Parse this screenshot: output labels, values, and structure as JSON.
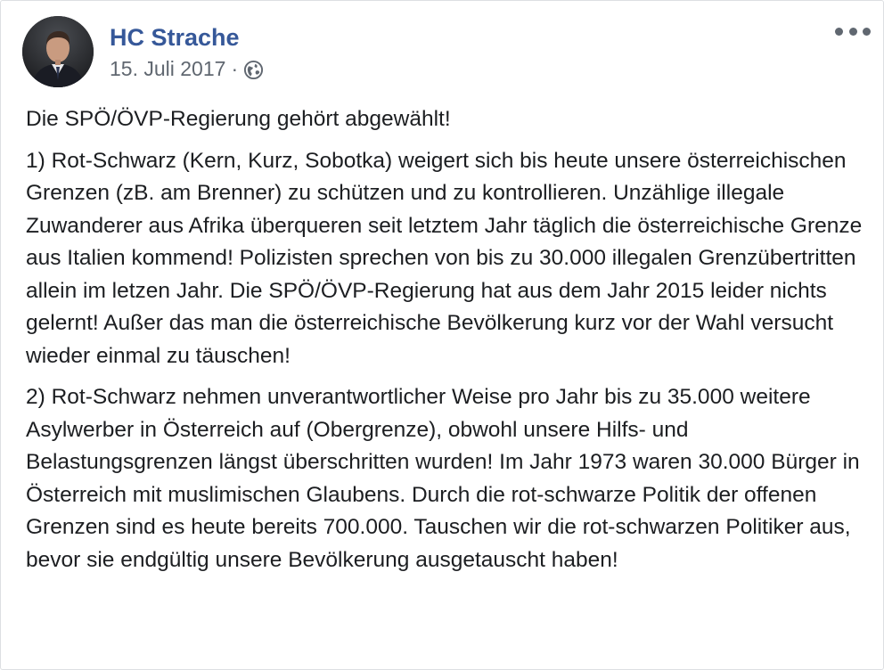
{
  "post": {
    "author": "HC Strache",
    "date": "15. Juli 2017",
    "separator": "·",
    "privacy_icon": "globe-icon",
    "more_icon": "more-options-icon",
    "paragraphs": [
      "Die SPÖ/ÖVP-Regierung gehört abgewählt!",
      "1) Rot-Schwarz (Kern, Kurz, Sobotka) weigert sich bis heute unsere österreichischen Grenzen (zB. am Brenner) zu schützen und zu kontrollieren. Unzählige illegale Zuwanderer aus Afrika überqueren seit letztem Jahr täglich die österreichische Grenze aus Italien kommend! Polizisten sprechen von bis zu 30.000 illegalen Grenzübertritten allein im letzen Jahr. Die SPÖ/ÖVP-Regierung hat aus dem Jahr 2015 leider nichts gelernt! Außer das man die österreichische Bevölkerung kurz vor der Wahl versucht wieder einmal zu täuschen!",
      "2) Rot-Schwarz nehmen unverantwortlicher Weise pro Jahr bis zu 35.000 weitere Asylwerber in Österreich auf (Obergrenze), obwohl unsere Hilfs- und Belastungsgrenzen längst überschritten wurden! Im Jahr 1973 waren 30.000 Bürger in Österreich mit muslimischen Glaubens. Durch die rot-schwarze Politik der offenen Grenzen sind es heute bereits 700.000. Tauschen wir die rot-schwarzen Politiker aus, bevor sie endgültig unsere Bevölkerung ausgetauscht haben!"
    ]
  },
  "colors": {
    "author_link": "#365899",
    "secondary_text": "#606770",
    "body_text": "#1c1e21"
  }
}
